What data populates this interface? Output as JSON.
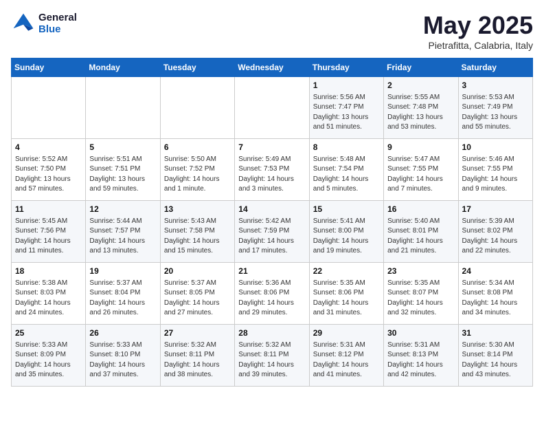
{
  "header": {
    "logo_line1": "General",
    "logo_line2": "Blue",
    "month": "May 2025",
    "location": "Pietrafitta, Calabria, Italy"
  },
  "weekdays": [
    "Sunday",
    "Monday",
    "Tuesday",
    "Wednesday",
    "Thursday",
    "Friday",
    "Saturday"
  ],
  "weeks": [
    [
      {
        "day": "",
        "info": ""
      },
      {
        "day": "",
        "info": ""
      },
      {
        "day": "",
        "info": ""
      },
      {
        "day": "",
        "info": ""
      },
      {
        "day": "1",
        "info": "Sunrise: 5:56 AM\nSunset: 7:47 PM\nDaylight: 13 hours\nand 51 minutes."
      },
      {
        "day": "2",
        "info": "Sunrise: 5:55 AM\nSunset: 7:48 PM\nDaylight: 13 hours\nand 53 minutes."
      },
      {
        "day": "3",
        "info": "Sunrise: 5:53 AM\nSunset: 7:49 PM\nDaylight: 13 hours\nand 55 minutes."
      }
    ],
    [
      {
        "day": "4",
        "info": "Sunrise: 5:52 AM\nSunset: 7:50 PM\nDaylight: 13 hours\nand 57 minutes."
      },
      {
        "day": "5",
        "info": "Sunrise: 5:51 AM\nSunset: 7:51 PM\nDaylight: 13 hours\nand 59 minutes."
      },
      {
        "day": "6",
        "info": "Sunrise: 5:50 AM\nSunset: 7:52 PM\nDaylight: 14 hours\nand 1 minute."
      },
      {
        "day": "7",
        "info": "Sunrise: 5:49 AM\nSunset: 7:53 PM\nDaylight: 14 hours\nand 3 minutes."
      },
      {
        "day": "8",
        "info": "Sunrise: 5:48 AM\nSunset: 7:54 PM\nDaylight: 14 hours\nand 5 minutes."
      },
      {
        "day": "9",
        "info": "Sunrise: 5:47 AM\nSunset: 7:55 PM\nDaylight: 14 hours\nand 7 minutes."
      },
      {
        "day": "10",
        "info": "Sunrise: 5:46 AM\nSunset: 7:55 PM\nDaylight: 14 hours\nand 9 minutes."
      }
    ],
    [
      {
        "day": "11",
        "info": "Sunrise: 5:45 AM\nSunset: 7:56 PM\nDaylight: 14 hours\nand 11 minutes."
      },
      {
        "day": "12",
        "info": "Sunrise: 5:44 AM\nSunset: 7:57 PM\nDaylight: 14 hours\nand 13 minutes."
      },
      {
        "day": "13",
        "info": "Sunrise: 5:43 AM\nSunset: 7:58 PM\nDaylight: 14 hours\nand 15 minutes."
      },
      {
        "day": "14",
        "info": "Sunrise: 5:42 AM\nSunset: 7:59 PM\nDaylight: 14 hours\nand 17 minutes."
      },
      {
        "day": "15",
        "info": "Sunrise: 5:41 AM\nSunset: 8:00 PM\nDaylight: 14 hours\nand 19 minutes."
      },
      {
        "day": "16",
        "info": "Sunrise: 5:40 AM\nSunset: 8:01 PM\nDaylight: 14 hours\nand 21 minutes."
      },
      {
        "day": "17",
        "info": "Sunrise: 5:39 AM\nSunset: 8:02 PM\nDaylight: 14 hours\nand 22 minutes."
      }
    ],
    [
      {
        "day": "18",
        "info": "Sunrise: 5:38 AM\nSunset: 8:03 PM\nDaylight: 14 hours\nand 24 minutes."
      },
      {
        "day": "19",
        "info": "Sunrise: 5:37 AM\nSunset: 8:04 PM\nDaylight: 14 hours\nand 26 minutes."
      },
      {
        "day": "20",
        "info": "Sunrise: 5:37 AM\nSunset: 8:05 PM\nDaylight: 14 hours\nand 27 minutes."
      },
      {
        "day": "21",
        "info": "Sunrise: 5:36 AM\nSunset: 8:06 PM\nDaylight: 14 hours\nand 29 minutes."
      },
      {
        "day": "22",
        "info": "Sunrise: 5:35 AM\nSunset: 8:06 PM\nDaylight: 14 hours\nand 31 minutes."
      },
      {
        "day": "23",
        "info": "Sunrise: 5:35 AM\nSunset: 8:07 PM\nDaylight: 14 hours\nand 32 minutes."
      },
      {
        "day": "24",
        "info": "Sunrise: 5:34 AM\nSunset: 8:08 PM\nDaylight: 14 hours\nand 34 minutes."
      }
    ],
    [
      {
        "day": "25",
        "info": "Sunrise: 5:33 AM\nSunset: 8:09 PM\nDaylight: 14 hours\nand 35 minutes."
      },
      {
        "day": "26",
        "info": "Sunrise: 5:33 AM\nSunset: 8:10 PM\nDaylight: 14 hours\nand 37 minutes."
      },
      {
        "day": "27",
        "info": "Sunrise: 5:32 AM\nSunset: 8:11 PM\nDaylight: 14 hours\nand 38 minutes."
      },
      {
        "day": "28",
        "info": "Sunrise: 5:32 AM\nSunset: 8:11 PM\nDaylight: 14 hours\nand 39 minutes."
      },
      {
        "day": "29",
        "info": "Sunrise: 5:31 AM\nSunset: 8:12 PM\nDaylight: 14 hours\nand 41 minutes."
      },
      {
        "day": "30",
        "info": "Sunrise: 5:31 AM\nSunset: 8:13 PM\nDaylight: 14 hours\nand 42 minutes."
      },
      {
        "day": "31",
        "info": "Sunrise: 5:30 AM\nSunset: 8:14 PM\nDaylight: 14 hours\nand 43 minutes."
      }
    ]
  ]
}
